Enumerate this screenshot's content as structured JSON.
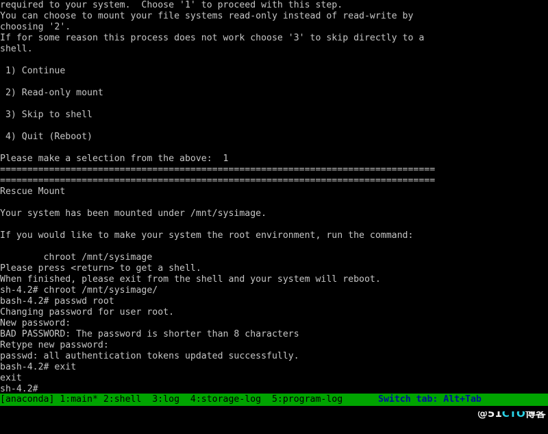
{
  "terminal": {
    "foreground_color": "#c6c6c6",
    "background_color": "#000000",
    "lines": [
      "required to your system.  Choose '1' to proceed with this step.",
      "You can choose to mount your file systems read-only instead of read-write by",
      "choosing '2'.",
      "If for some reason this process does not work choose '3' to skip directly to a",
      "shell.",
      "",
      " 1) Continue",
      "",
      " 2) Read-only mount",
      "",
      " 3) Skip to shell",
      "",
      " 4) Quit (Reboot)",
      "",
      "Please make a selection from the above:  1",
      "================================================================================",
      "================================================================================",
      "Rescue Mount",
      "",
      "Your system has been mounted under /mnt/sysimage.",
      "",
      "If you would like to make your system the root environment, run the command:",
      "",
      "        chroot /mnt/sysimage",
      "Please press <return> to get a shell.",
      "When finished, please exit from the shell and your system will reboot.",
      "sh-4.2# chroot /mnt/sysimage/",
      "bash-4.2# passwd root",
      "Changing password for user root.",
      "New password:",
      "BAD PASSWORD: The password is shorter than 8 characters",
      "Retype new password:",
      "passwd: all authentication tokens updated successfully.",
      "bash-4.2# exit",
      "exit",
      "sh-4.2#"
    ],
    "prompt_selection_value": "1",
    "shell_prompts": [
      "sh-4.2#",
      "bash-4.2#"
    ]
  },
  "statusbar": {
    "background_color": "#00a400",
    "text_color": "#000000",
    "hint_color": "#00109c",
    "session_label": "[anaconda]",
    "tabs": [
      {
        "index": "1",
        "name": "main",
        "active_marker": "*",
        "label": "1:main*"
      },
      {
        "index": "2",
        "name": "shell",
        "active_marker": "",
        "label": "2:shell"
      },
      {
        "index": "3",
        "name": "log",
        "active_marker": "",
        "label": "3:log"
      },
      {
        "index": "4",
        "name": "storage-log",
        "active_marker": "",
        "label": "4:storage-log"
      },
      {
        "index": "5",
        "name": "program-log",
        "active_marker": "",
        "label": "5:program-log"
      }
    ],
    "left_text": "[anaconda] 1:main* 2:shell  3:log  4:storage-log  5:program-log",
    "hint_text": "Switch tab: Alt+Tab"
  },
  "watermark": {
    "at": "@",
    "number": "51",
    "brand": "CTO",
    "suffix": "博客",
    "full_text": "@51CTO博客"
  }
}
